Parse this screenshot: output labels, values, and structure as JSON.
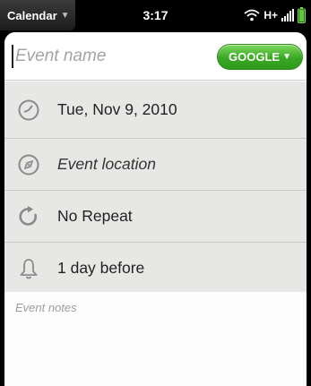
{
  "status_bar": {
    "app_name": "Calendar",
    "time": "3:17",
    "network": "H+",
    "icons": [
      "wifi-icon",
      "signal-icon",
      "battery-icon"
    ]
  },
  "event_form": {
    "name_placeholder": "Event name",
    "calendar_account": "GOOGLE",
    "date": "Tue, Nov 9, 2010",
    "location_placeholder": "Event location",
    "repeat": "No Repeat",
    "reminder": "1 day before",
    "notes_placeholder": "Event notes"
  },
  "colors": {
    "google_button": "#3aa824",
    "row_background": "#e7e7e5",
    "icon_gray": "#8a8a8a"
  }
}
